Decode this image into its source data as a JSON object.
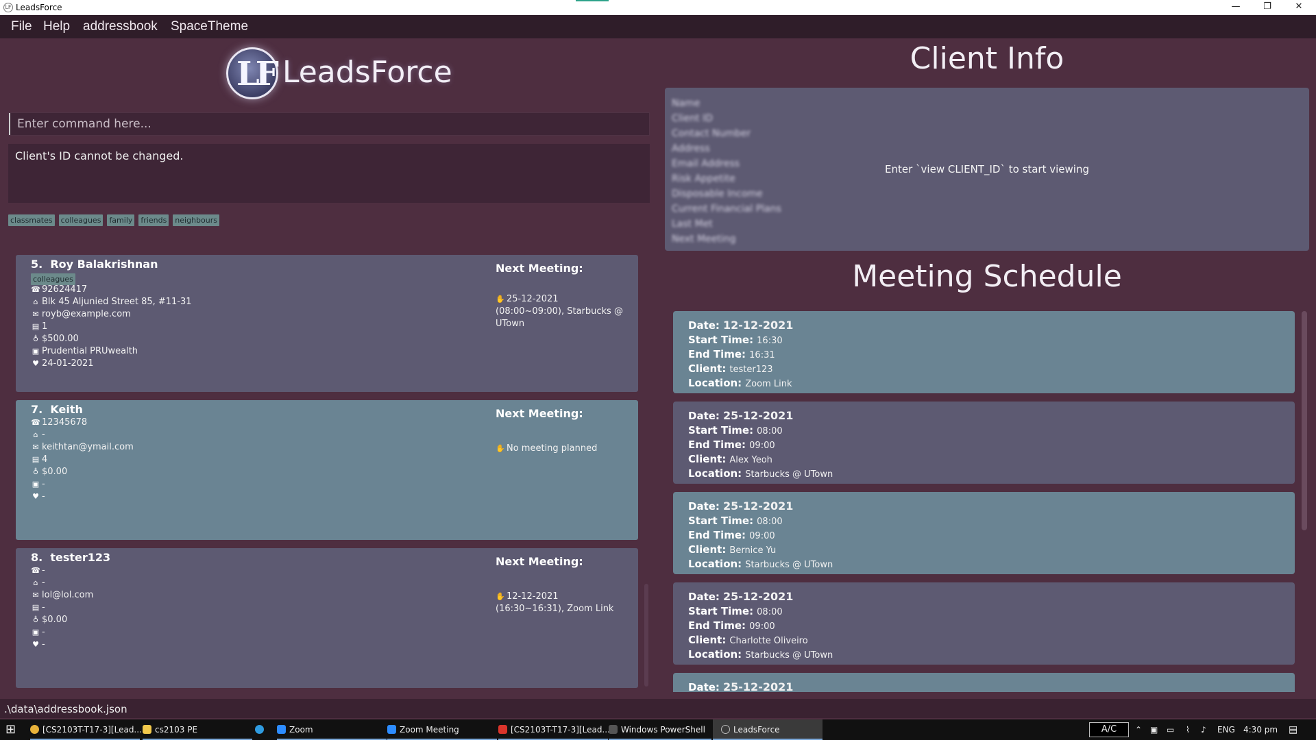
{
  "window": {
    "title": "LeadsForce",
    "minimize": "—",
    "maximize": "❐",
    "close": "✕"
  },
  "menu": [
    "File",
    "Help",
    "addressbook",
    "SpaceTheme"
  ],
  "logo": {
    "letters": "LF",
    "text": "LeadsForce"
  },
  "command": {
    "placeholder": "Enter command here..."
  },
  "result": "Client's ID cannot be changed.",
  "tags": [
    "classmates",
    "colleagues",
    "family",
    "friends",
    "neighbours"
  ],
  "clients": [
    {
      "index": "5.",
      "name": "Roy Balakrishnan",
      "tag": "colleagues",
      "phone": "92624417",
      "address": "Blk 45 Aljunied Street 85, #11-31",
      "email": "royb@example.com",
      "risk": "1",
      "income": "$500.00",
      "plans": "Prudential PRUwealth",
      "last_met": "24-01-2021",
      "next_meeting_label": "Next Meeting:",
      "next_meeting": "25-12-2021 (08:00~09:00), Starbucks @ UTown"
    },
    {
      "index": "7.",
      "name": "Keith",
      "tag": "",
      "phone": "12345678",
      "address": "-",
      "email": "keithtan@ymail.com",
      "risk": "4",
      "income": "$0.00",
      "plans": "-",
      "last_met": "-",
      "next_meeting_label": "Next Meeting:",
      "next_meeting": "No meeting planned"
    },
    {
      "index": "8.",
      "name": "tester123",
      "tag": "",
      "phone": "-",
      "address": "-",
      "email": "lol@lol.com",
      "risk": "-",
      "income": "$0.00",
      "plans": "-",
      "last_met": "-",
      "next_meeting_label": "Next Meeting:",
      "next_meeting": "12-12-2021 (16:30~16:31), Zoom Link"
    }
  ],
  "status_bar": ".\\data\\addressbook.json",
  "client_info": {
    "title": "Client Info",
    "fields": [
      "Name",
      "Client ID",
      "Contact Number",
      "Address",
      "Email Address",
      "Risk Appetite",
      "Disposable Income",
      "Current Financial Plans",
      "Last Met",
      "Next Meeting"
    ],
    "hint": "Enter `view CLIENT_ID` to start viewing"
  },
  "meeting_schedule": {
    "title": "Meeting Schedule",
    "labels": {
      "date": "Date:",
      "start": "Start Time:",
      "end": "End Time:",
      "client": "Client:",
      "location": "Location:"
    },
    "meetings": [
      {
        "date": "12-12-2021",
        "start": "16:30",
        "end": "16:31",
        "client": "tester123",
        "location": "Zoom Link"
      },
      {
        "date": "25-12-2021",
        "start": "08:00",
        "end": "09:00",
        "client": "Alex Yeoh",
        "location": "Starbucks @ UTown"
      },
      {
        "date": "25-12-2021",
        "start": "08:00",
        "end": "09:00",
        "client": "Bernice Yu",
        "location": "Starbucks @ UTown"
      },
      {
        "date": "25-12-2021",
        "start": "08:00",
        "end": "09:00",
        "client": "Charlotte Oliveiro",
        "location": "Starbucks @ UTown"
      },
      {
        "date": "25-12-2021"
      }
    ]
  },
  "taskbar": {
    "items": [
      "[CS2103T-T17-3][Lead...",
      "cs2103 PE",
      "",
      "Zoom",
      "Zoom Meeting",
      "[CS2103T-T17-3][Lead...",
      "Windows PowerShell",
      "LeadsForce"
    ],
    "ac": "A/C",
    "language": "ENG",
    "time": "4:30 pm"
  },
  "colors": {
    "background": "#4e2e40",
    "card_dark": "#5d5a72",
    "card_teal": "#6a8493",
    "menubar": "#2f1d29"
  }
}
